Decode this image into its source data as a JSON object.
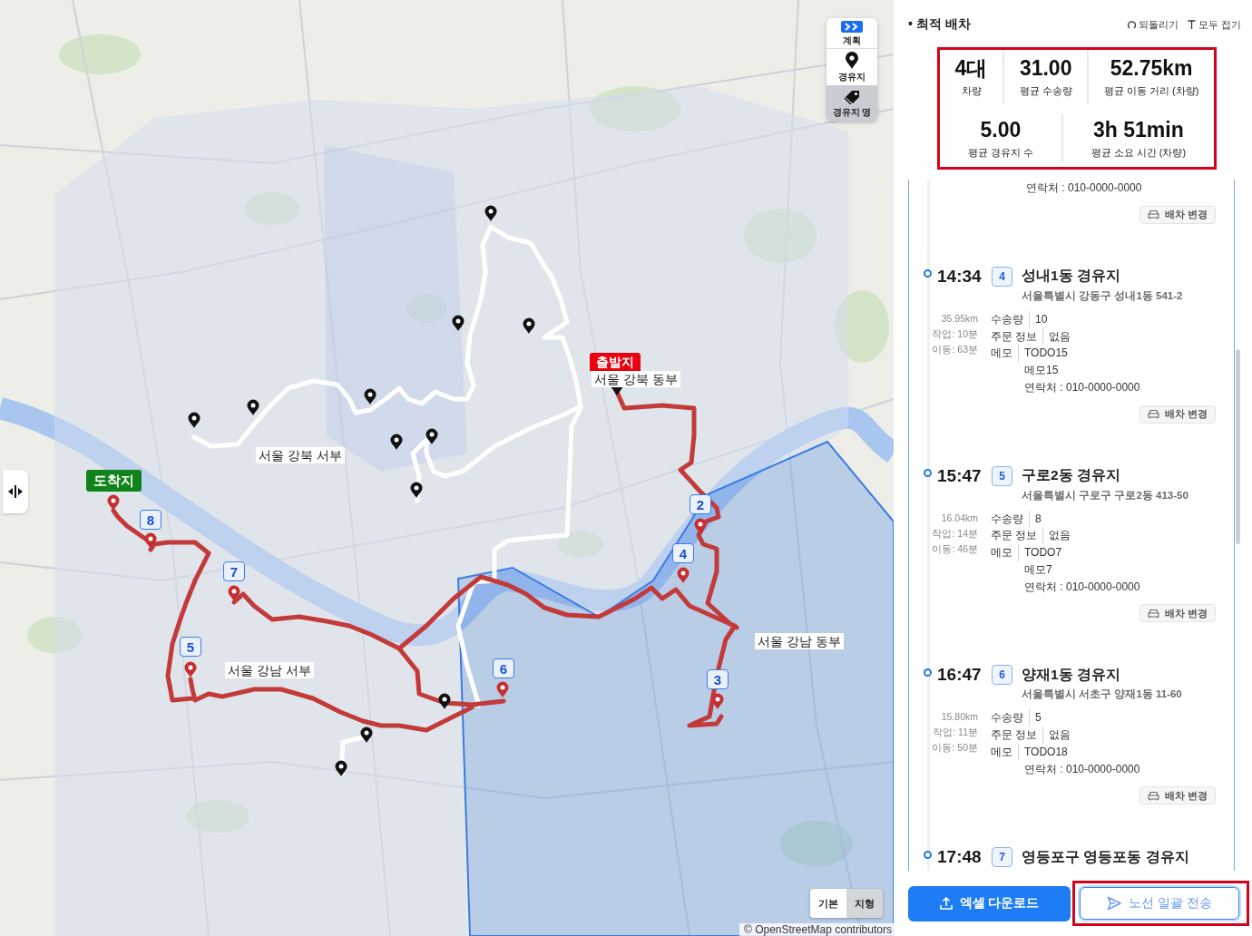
{
  "map": {
    "controls": [
      {
        "kind": "plan",
        "label": "계획",
        "selected": false
      },
      {
        "kind": "waypoint",
        "label": "경유지",
        "selected": false
      },
      {
        "kind": "waypoint_name",
        "label": "경유지 명",
        "selected": true
      }
    ],
    "start_label": "출발지",
    "end_label": "도착지",
    "zone_labels": [
      "서울 강북 동부",
      "서울 강북 서부",
      "서울 강남 서부",
      "서울 강남 동부"
    ],
    "stop_badges": [
      "2",
      "3",
      "4",
      "5",
      "6",
      "7",
      "8"
    ],
    "base_layers": [
      {
        "label": "기본",
        "selected": false
      },
      {
        "label": "지형",
        "selected": true
      }
    ],
    "attribution": "© OpenStreetMap contributors"
  },
  "panel": {
    "title": "• 최적 배차",
    "actions": [
      {
        "kind": "undo",
        "label": "되돌리기"
      },
      {
        "kind": "collapse",
        "label": "모두 접기"
      }
    ],
    "summary": {
      "highlighted": true,
      "stats": [
        {
          "value": "4대",
          "label": "차량"
        },
        {
          "value": "31.00",
          "label": "평균 수송량"
        },
        {
          "value": "52.75km",
          "label": "평균 이동 거리 (차량)"
        },
        {
          "value": "5.00",
          "label": "평균 경유지 수"
        },
        {
          "value": "3h 51min",
          "label": "평균 소요 시간 (차량)"
        }
      ]
    },
    "stops": [
      {
        "details": [
          {
            "values": [
              "연락처 : 010-0000-0000"
            ]
          }
        ],
        "action": "배차 변경"
      },
      {
        "time": "14:34",
        "number": "4",
        "name": "성내1동 경유지",
        "address": "서울특별시 강동구 성내1동 541-2",
        "meta": [
          "35.95km",
          "작업: 10분",
          "이동: 63분"
        ],
        "details": [
          {
            "key": "수송량",
            "values": [
              "10"
            ]
          },
          {
            "key": "주문 정보",
            "values": [
              "없음"
            ]
          },
          {
            "key": "메모",
            "values": [
              "TODO15",
              "메모15",
              "연락처 : 010-0000-0000"
            ]
          }
        ],
        "action": "배차 변경"
      },
      {
        "time": "15:47",
        "number": "5",
        "name": "구로2동 경유지",
        "address": "서울특별시 구로구 구로2동 413-50",
        "meta": [
          "16.04km",
          "작업: 14분",
          "이동: 46분"
        ],
        "details": [
          {
            "key": "수송량",
            "values": [
              "8"
            ]
          },
          {
            "key": "주문 정보",
            "values": [
              "없음"
            ]
          },
          {
            "key": "메모",
            "values": [
              "TODO7",
              "메모7",
              "연락처 : 010-0000-0000"
            ]
          }
        ],
        "action": "배차 변경"
      },
      {
        "time": "16:47",
        "number": "6",
        "name": "양재1동 경유지",
        "address": "서울특별시 서초구 양재1동 11-60",
        "meta": [
          "15.80km",
          "작업: 11분",
          "이동: 50분"
        ],
        "details": [
          {
            "key": "수송량",
            "values": [
              "5"
            ]
          },
          {
            "key": "주문 정보",
            "values": [
              "없음"
            ]
          },
          {
            "key": "메모",
            "values": [
              "TODO18",
              "연락처 : 010-0000-0000"
            ]
          }
        ],
        "action": "배차 변경"
      },
      {
        "time": "17:48",
        "number": "7",
        "name": "영등포구 영등포동 경유지"
      }
    ],
    "buttons": [
      {
        "kind": "download",
        "label": "엑셀 다운로드",
        "highlighted": false
      },
      {
        "kind": "send",
        "label": "노선 일괄 전송",
        "highlighted": true
      }
    ]
  }
}
